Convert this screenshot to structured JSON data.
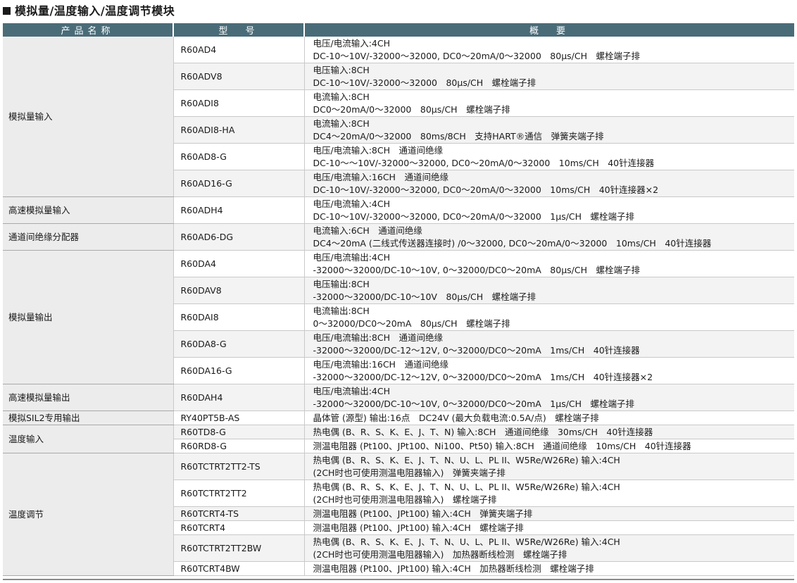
{
  "title": "模拟量/温度输入/温度调节模块",
  "headers": {
    "name": "产品名称",
    "model": "型　号",
    "summary": "概　要"
  },
  "groups": [
    {
      "name": "模拟量输入",
      "rows": [
        {
          "model": "R60AD4",
          "lines": [
            "电压/电流输入:4CH",
            "DC-10～10V/-32000～32000, DC0～20mA/0～32000　80μs/CH　螺栓端子排"
          ]
        },
        {
          "model": "R60ADV8",
          "lines": [
            "电压输入:8CH",
            "DC-10～10V/-32000～32000　80μs/CH　螺栓端子排"
          ]
        },
        {
          "model": "R60ADI8",
          "lines": [
            "电流输入:8CH",
            "DC0～20mA/0～32000　80μs/CH　螺栓端子排"
          ]
        },
        {
          "model": "R60ADI8-HA",
          "lines": [
            "电流输入:8CH",
            "DC4～20mA/0～32000　80ms/8CH　支持HART®通信　弹簧夹端子排"
          ]
        },
        {
          "model": "R60AD8-G",
          "lines": [
            "电压/电流输入:8CH　通道间绝缘",
            "DC-10～～10V/-32000～32000, DC0～20mA/0～32000　10ms/CH　40针连接器"
          ]
        },
        {
          "model": "R60AD16-G",
          "lines": [
            "电压/电流输入:16CH　通道间绝缘",
            "DC-10～10V/-32000～32000, DC0～20mA/0～32000　10ms/CH　40针连接器×2"
          ]
        }
      ]
    },
    {
      "name": "高速模拟量输入",
      "rows": [
        {
          "model": "R60ADH4",
          "lines": [
            "电压/电流输入:4CH",
            "DC-10～10V/-32000～32000, DC0～20mA/0～32000　1μs/CH　螺栓端子排"
          ]
        }
      ]
    },
    {
      "name": "通道间绝缘分配器",
      "rows": [
        {
          "model": "R60AD6-DG",
          "lines": [
            "电流输入:6CH　通道间绝缘",
            "DC4～20mA (二线式传送器连接时) /0～32000, DC0～20mA/0～32000　10ms/CH　40针连接器"
          ]
        }
      ]
    },
    {
      "name": "模拟量输出",
      "rows": [
        {
          "model": "R60DA4",
          "lines": [
            "电压/电流输出:4CH",
            "-32000～32000/DC-10～10V, 0～32000/DC0～20mA　80μs/CH　螺栓端子排"
          ]
        },
        {
          "model": "R60DAV8",
          "lines": [
            "电压输出:8CH",
            "-32000～32000/DC-10～10V　80μs/CH　螺栓端子排"
          ]
        },
        {
          "model": "R60DAI8",
          "lines": [
            "电流输出:8CH",
            "0～32000/DC0～20mA　80μs/CH　螺栓端子排"
          ]
        },
        {
          "model": "R60DA8-G",
          "lines": [
            "电压/电流输出:8CH　通道间绝缘",
            "-32000～32000/DC-12～12V, 0～32000/DC0～20mA　1ms/CH　40针连接器"
          ]
        },
        {
          "model": "R60DA16-G",
          "lines": [
            "电压/电流输出:16CH　通道间绝缘",
            "-32000～32000/DC-12～12V, 0～32000/DC0～20mA　1ms/CH　40针连接器×2"
          ]
        }
      ]
    },
    {
      "name": "高速模拟量输出",
      "rows": [
        {
          "model": "R60DAH4",
          "lines": [
            "电压/电流输出:4CH",
            "-32000～32000/DC-10～10V, 0～32000/DC0～20mA　1μs/CH　螺栓端子排"
          ]
        }
      ]
    },
    {
      "name": "模拟SIL2专用输出",
      "rows": [
        {
          "model": "RY40PT5B-AS",
          "lines": [
            "晶体管 (源型) 输出:16点　DC24V (最大负载电流:0.5A/点)　螺栓端子排"
          ]
        }
      ]
    },
    {
      "name": "温度输入",
      "rows": [
        {
          "model": "R60TD8-G",
          "lines": [
            "热电偶 (B、R、S、K、E、J、T、N) 输入:8CH　通道间绝缘　30ms/CH　40针连接器"
          ]
        },
        {
          "model": "R60RD8-G",
          "lines": [
            "测温电阻器 (Pt100、JPt100、Ni100、Pt50) 输入:8CH　通道间绝缘　10ms/CH　40针连接器"
          ]
        }
      ]
    },
    {
      "name": "温度调节",
      "rows": [
        {
          "model": "R60TCTRT2TT2-TS",
          "lines": [
            "热电偶 (B、R、S、K、E、J、T、N、U、L、PL II、W5Re/W26Re) 输入:4CH",
            "(2CH时也可使用测温电阻器输入)　弹簧夹端子排"
          ]
        },
        {
          "model": "R60TCTRT2TT2",
          "lines": [
            "热电偶 (B、R、S、K、E、J、T、N、U、L、PL II、W5Re/W26Re) 输入:4CH",
            "(2CH时也可使用测温电阻器输入)　螺栓端子排"
          ]
        },
        {
          "model": "R60TCRT4-TS",
          "lines": [
            "测温电阻器 (Pt100、JPt100) 输入:4CH　弹簧夹端子排"
          ]
        },
        {
          "model": "R60TCRT4",
          "lines": [
            "测温电阻器 (Pt100、JPt100) 输入:4CH　螺栓端子排"
          ]
        },
        {
          "model": "R60TCTRT2TT2BW",
          "lines": [
            "热电偶 (B、R、S、K、E、J、T、N、U、L、PL II、W5Re/W26Re) 输入:4CH",
            "(2CH时也可使用测温电阻器输入)　加热器断线检测　螺栓端子排"
          ]
        },
        {
          "model": "R60TCRT4BW",
          "lines": [
            "测温电阻器 (Pt100、JPt100) 输入:4CH　加热器断线检测　螺栓端子排"
          ]
        }
      ]
    }
  ]
}
